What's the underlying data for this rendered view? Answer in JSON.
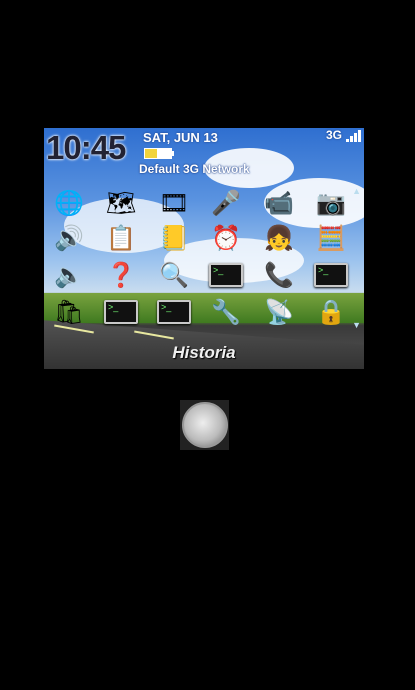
{
  "status_bar": {
    "time": "10:45",
    "date": "SAT, JUN 13",
    "network_name": "Default 3G Network",
    "network_type": "3G",
    "battery_level": 0.45,
    "signal_bars": 4
  },
  "home_screen": {
    "selected_label": "Historia",
    "icons": [
      {
        "name": "browser-icon",
        "glyph": "🌐"
      },
      {
        "name": "maps-icon",
        "glyph": "🗺"
      },
      {
        "name": "media-icon",
        "glyph": "🎞"
      },
      {
        "name": "voice-notes-icon",
        "glyph": "🎤"
      },
      {
        "name": "video-camera-icon",
        "glyph": "📹"
      },
      {
        "name": "camera-icon",
        "glyph": "📷"
      },
      {
        "name": "sound-profile-icon",
        "glyph": "🔊"
      },
      {
        "name": "tasks-icon",
        "glyph": "📋"
      },
      {
        "name": "memo-pad-icon",
        "glyph": "📒"
      },
      {
        "name": "alarm-clock-icon",
        "glyph": "⏰"
      },
      {
        "name": "contact-avatar-icon",
        "glyph": "👧"
      },
      {
        "name": "calculator-icon",
        "glyph": "🧮"
      },
      {
        "name": "speaker-box-icon",
        "glyph": "🔈"
      },
      {
        "name": "help-icon",
        "glyph": "❓"
      },
      {
        "name": "search-icon",
        "glyph": "🔍"
      },
      {
        "name": "terminal-app-icon",
        "glyph": ">_"
      },
      {
        "name": "phone-icon",
        "glyph": "📞"
      },
      {
        "name": "terminal-app-icon",
        "glyph": ">_"
      },
      {
        "name": "app-world-icon",
        "glyph": "🛍"
      },
      {
        "name": "terminal-app-icon",
        "glyph": ">_"
      },
      {
        "name": "terminal-app-icon",
        "glyph": ">_"
      },
      {
        "name": "options-wrench-icon",
        "glyph": "🔧"
      },
      {
        "name": "wireless-setup-icon",
        "glyph": "📡"
      },
      {
        "name": "lock-icon",
        "glyph": "🔒"
      }
    ]
  },
  "hardware": {
    "trackball": "trackball-icon"
  }
}
